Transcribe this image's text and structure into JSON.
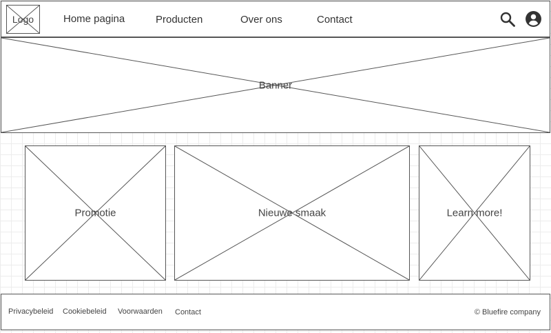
{
  "header": {
    "logo_label": "Logo",
    "nav": [
      "Home pagina",
      "Producten",
      "Over ons",
      "Contact"
    ],
    "icons": [
      "search-icon",
      "account-icon"
    ]
  },
  "banner": {
    "label": "Banner"
  },
  "cards": [
    {
      "label": "Promotie"
    },
    {
      "label": "Nieuwe smaak"
    },
    {
      "label": "Learn more!"
    }
  ],
  "footer": {
    "links": [
      "Privacybeleid",
      "Cookiebeleid",
      "Voorwaarden",
      "Contact"
    ],
    "copyright": "© Bluefire company"
  }
}
